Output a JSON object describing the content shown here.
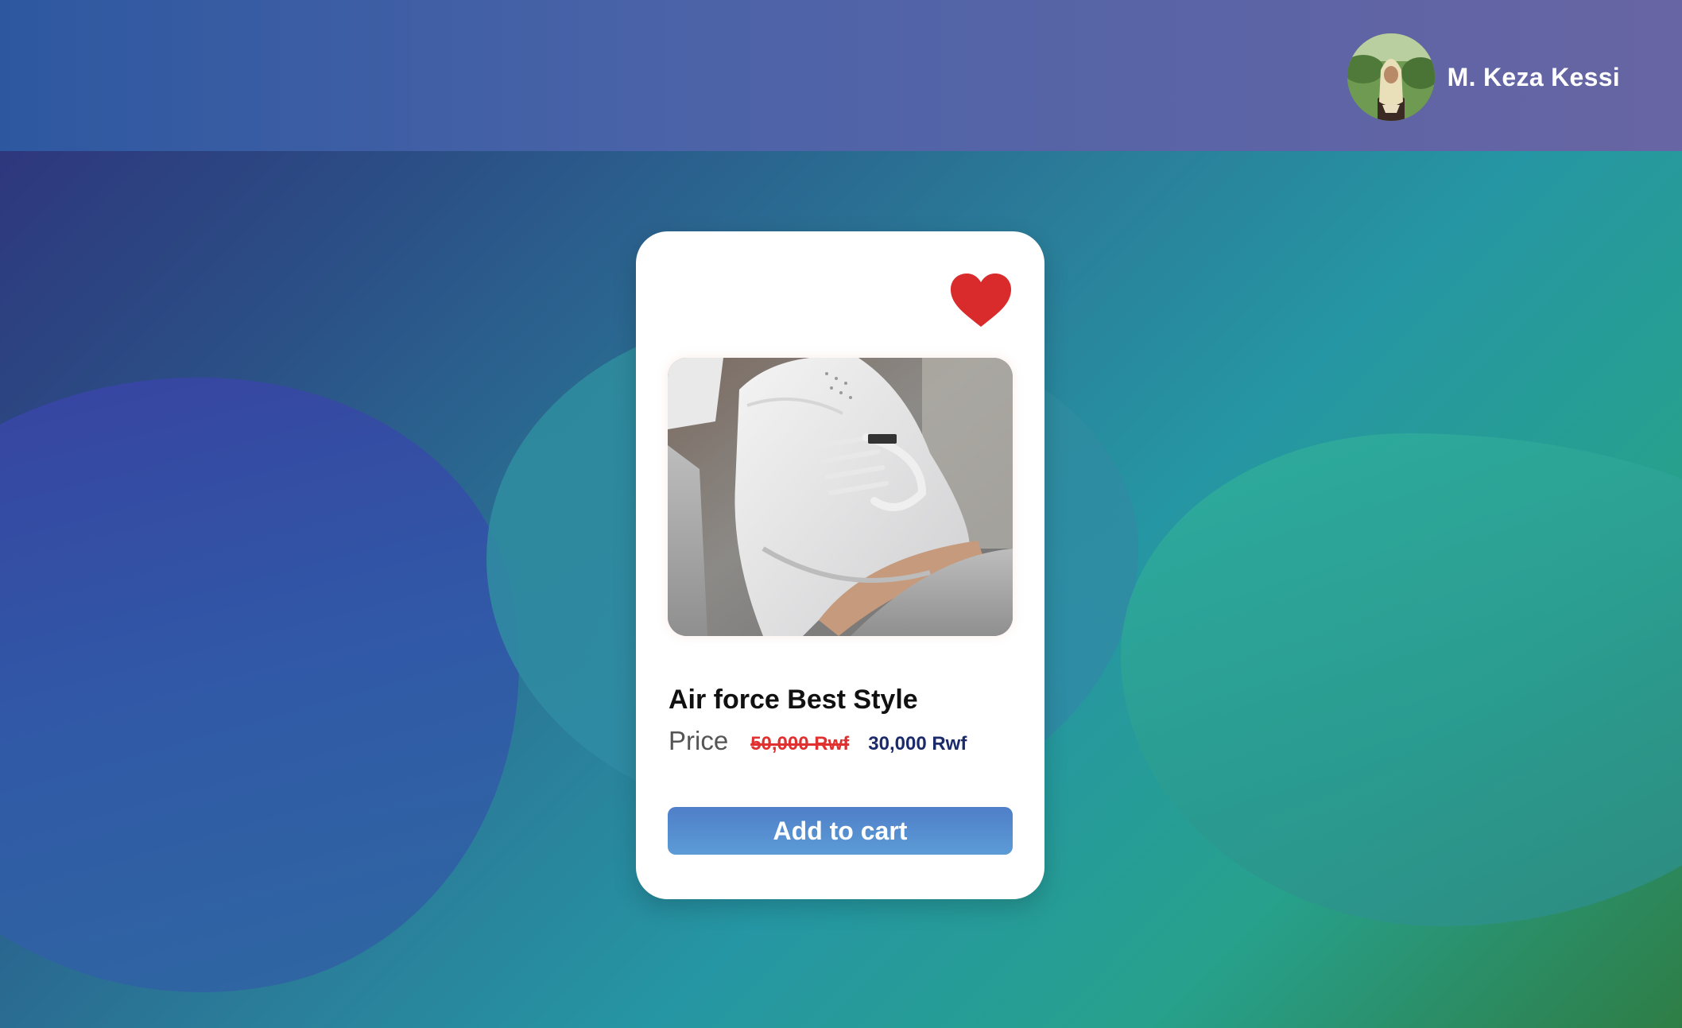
{
  "header": {
    "user_name": "M. Keza Kessi",
    "avatar_icon": "user-avatar"
  },
  "product": {
    "favorite_icon": "heart-icon",
    "favorite_color": "#d92b2b",
    "image_alt": "White sneaker",
    "name": "Air force Best Style",
    "price_label": "Price",
    "old_price": "50,000 Rwf",
    "new_price": "30,000 Rwf",
    "add_to_cart_label": "Add to cart"
  },
  "colors": {
    "button": "#5589cf",
    "old_price": "#e03030",
    "new_price": "#1b2a6b"
  }
}
